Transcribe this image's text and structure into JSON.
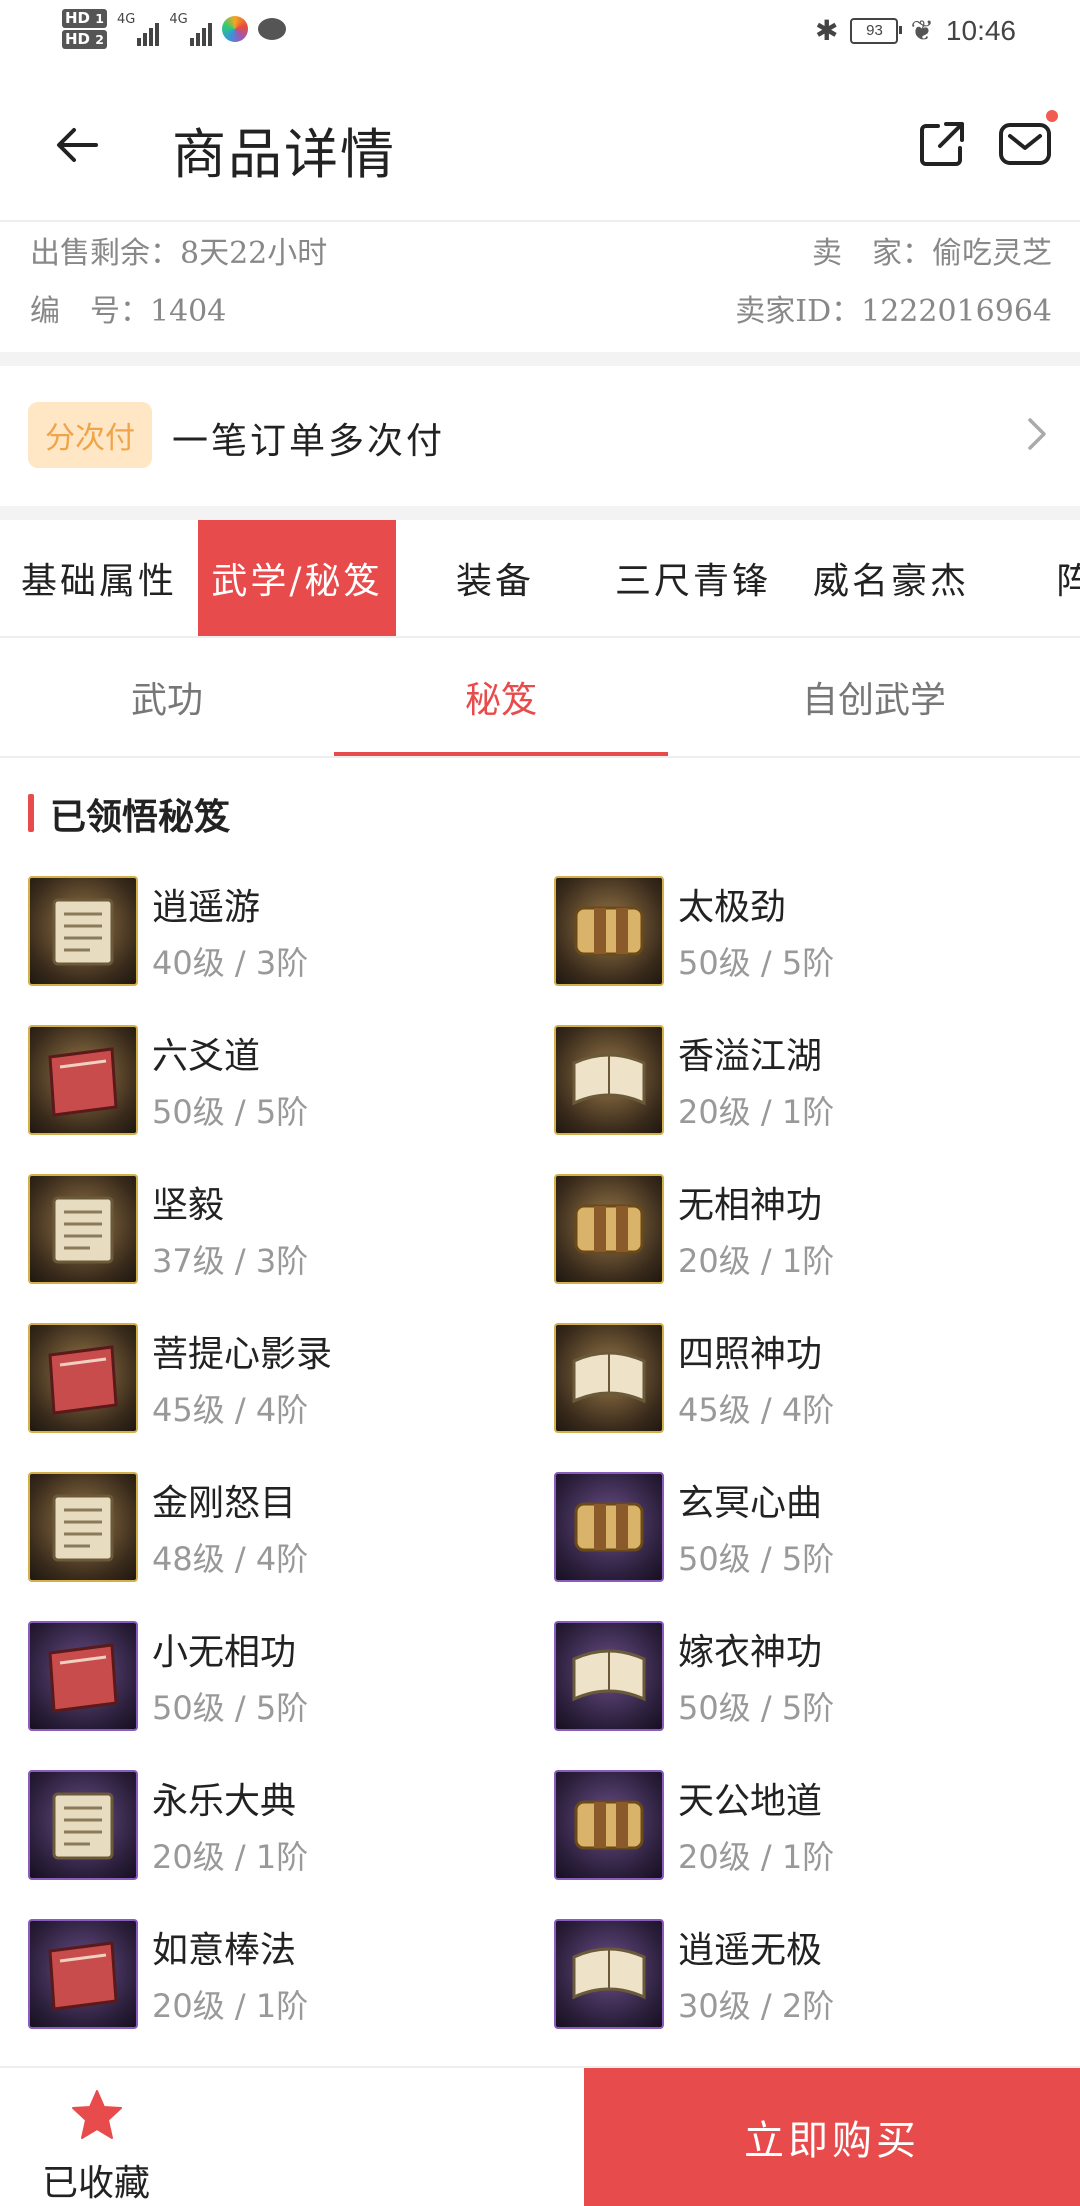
{
  "status_bar": {
    "hd1": "HD",
    "hd1_sub": "1",
    "hd2": "HD",
    "hd2_sub": "2",
    "net1": "4G",
    "net2": "4G",
    "battery": "93",
    "time": "10:46"
  },
  "header": {
    "title": "商品详情"
  },
  "info": {
    "remaining": "出售剩余：8天22小时",
    "seller": "卖　家：偷吃灵芝",
    "number": "编　号：1404",
    "seller_id": "卖家ID：1222016964"
  },
  "installment": {
    "badge": "分次付",
    "text": "一笔订单多次付"
  },
  "main_tabs": [
    "基础属性",
    "武学/秘笈",
    "装备",
    "三尺青锋",
    "威名豪杰",
    "阵"
  ],
  "sub_tabs": [
    "武功",
    "秘笈",
    "自创武学"
  ],
  "section_title": "已领悟秘笈",
  "items": [
    {
      "name": "逍遥游",
      "level": "40级 / 3阶",
      "frame": "gold"
    },
    {
      "name": "太极劲",
      "level": "50级 / 5阶",
      "frame": "gold"
    },
    {
      "name": "六爻道",
      "level": "50级 / 5阶",
      "frame": "gold"
    },
    {
      "name": "香溢江湖",
      "level": "20级 / 1阶",
      "frame": "gold"
    },
    {
      "name": "坚毅",
      "level": "37级 / 3阶",
      "frame": "gold"
    },
    {
      "name": "无相神功",
      "level": "20级 / 1阶",
      "frame": "gold"
    },
    {
      "name": "菩提心影录",
      "level": "45级 / 4阶",
      "frame": "gold"
    },
    {
      "name": "四照神功",
      "level": "45级 / 4阶",
      "frame": "gold"
    },
    {
      "name": "金刚怒目",
      "level": "48级 / 4阶",
      "frame": "gold"
    },
    {
      "name": "玄冥心曲",
      "level": "50级 / 5阶",
      "frame": "purple"
    },
    {
      "name": "小无相功",
      "level": "50级 / 5阶",
      "frame": "purple"
    },
    {
      "name": "嫁衣神功",
      "level": "50级 / 5阶",
      "frame": "purple"
    },
    {
      "name": "永乐大典",
      "level": "20级 / 1阶",
      "frame": "purple"
    },
    {
      "name": "天公地道",
      "level": "20级 / 1阶",
      "frame": "purple"
    },
    {
      "name": "如意棒法",
      "level": "20级 / 1阶",
      "frame": "purple"
    },
    {
      "name": "逍遥无极",
      "level": "30级 / 2阶",
      "frame": "purple"
    }
  ],
  "bottom": {
    "favorite_label": "已收藏",
    "buy_label": "立即购买"
  },
  "colors": {
    "accent": "#e84b4b",
    "badge_bg": "#ffe6c4",
    "badge_text": "#f0a44a",
    "muted_text": "#999999"
  }
}
